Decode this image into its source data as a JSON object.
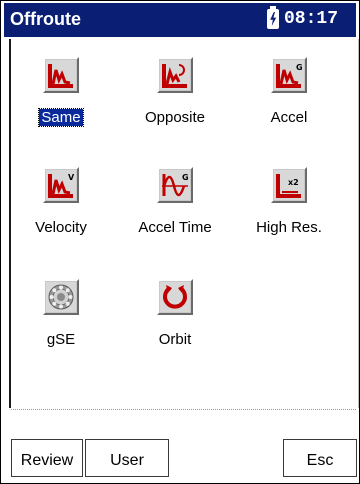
{
  "titlebar": {
    "title": "Offroute",
    "time": "08:17",
    "battery_icon": "battery-charging-icon"
  },
  "apps": [
    {
      "label": "Same",
      "icon": "spectrum-chart-icon",
      "selected": true
    },
    {
      "label": "Opposite",
      "icon": "spectrum-opposite-icon",
      "selected": false
    },
    {
      "label": "Accel",
      "icon": "spectrum-accel-icon",
      "selected": false
    },
    {
      "label": "Velocity",
      "icon": "spectrum-velocity-icon",
      "selected": false
    },
    {
      "label": "Accel Time",
      "icon": "waveform-time-icon",
      "selected": false
    },
    {
      "label": "High Res.",
      "icon": "high-resolution-icon",
      "selected": false
    },
    {
      "label": "gSE",
      "icon": "bearing-icon",
      "selected": false
    },
    {
      "label": "Orbit",
      "icon": "orbit-icon",
      "selected": false
    }
  ],
  "softkeys": {
    "review": "Review",
    "user": "User",
    "esc": "Esc"
  },
  "colors": {
    "titlebar_bg": "#0a1e74",
    "selection_bg": "#0a2a9c",
    "icon_red": "#c00000"
  }
}
